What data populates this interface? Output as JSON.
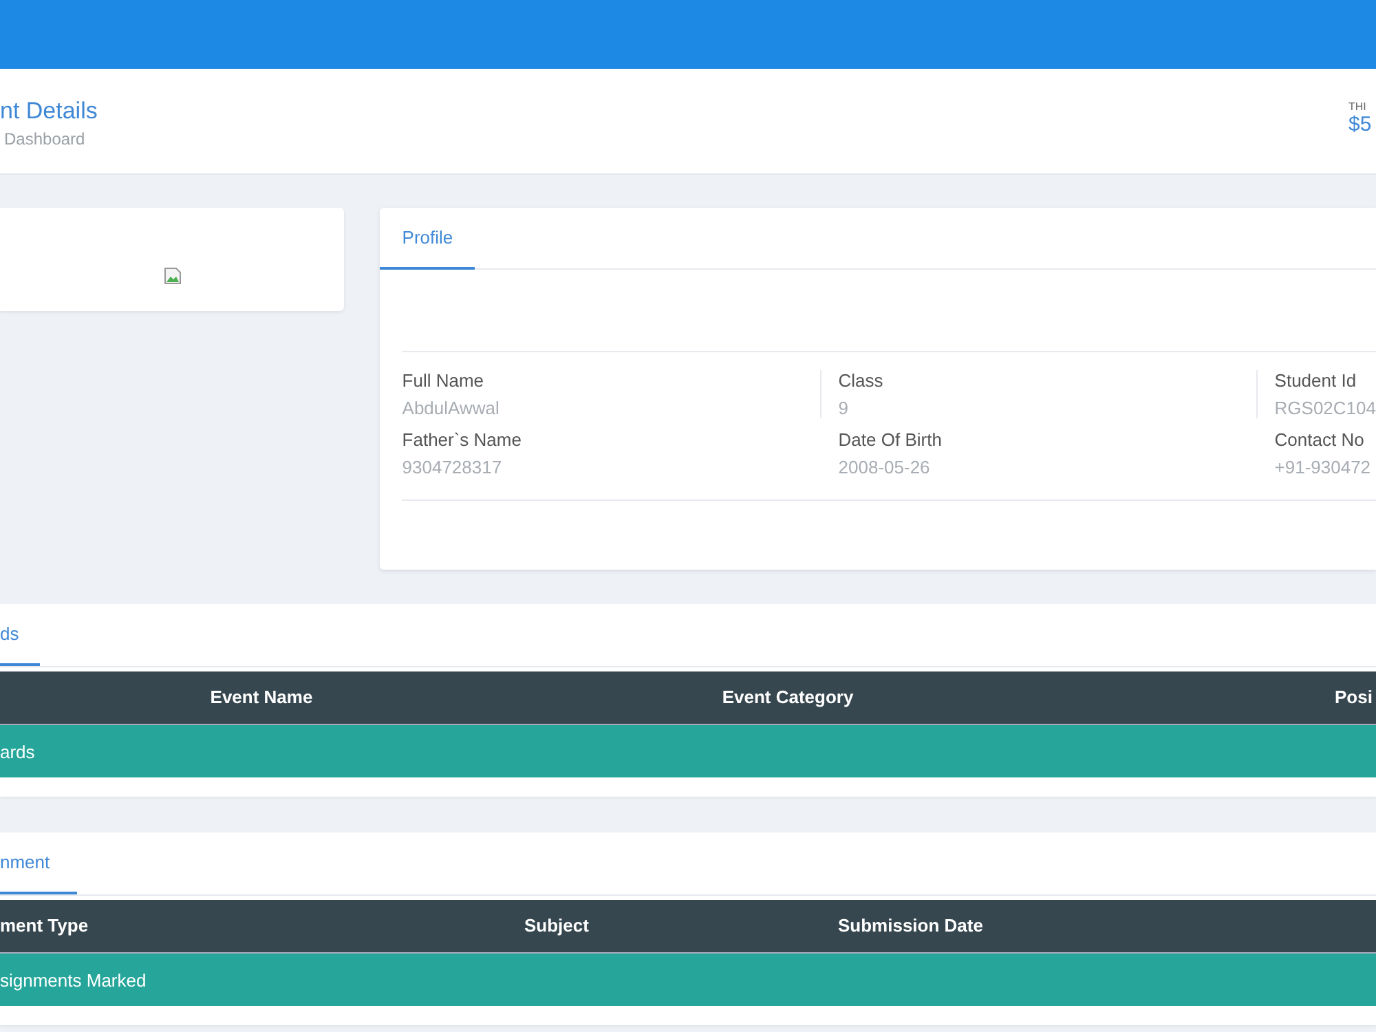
{
  "header": {
    "title": "nt Details",
    "breadcrumb": "Dashboard",
    "stat_label": "THI",
    "stat_value": "$5"
  },
  "photo_card": {
    "kind": "broken-image"
  },
  "profile": {
    "tabs": [
      {
        "label": "Profile",
        "selected": true
      }
    ],
    "fields": [
      {
        "label": "Full Name",
        "value": "AbdulAwwal"
      },
      {
        "label": "Class",
        "value": "9"
      },
      {
        "label": "Student Id",
        "value": "RGS02C104"
      },
      {
        "label": "Father`s Name",
        "value": "9304728317"
      },
      {
        "label": "Date Of Birth",
        "value": "2008-05-26"
      },
      {
        "label": "Contact No",
        "value": "+91-930472"
      }
    ]
  },
  "events": {
    "tabs": [
      {
        "label": "ds",
        "selected": true
      }
    ],
    "columns": [
      "Event Name",
      "Event Category",
      "Posi"
    ],
    "empty_message": "ards"
  },
  "assignments": {
    "tabs": [
      {
        "label": "nment",
        "selected": true
      }
    ],
    "columns": [
      "ment Type",
      "Subject",
      "Submission Date"
    ],
    "empty_message": "signments Marked"
  }
}
